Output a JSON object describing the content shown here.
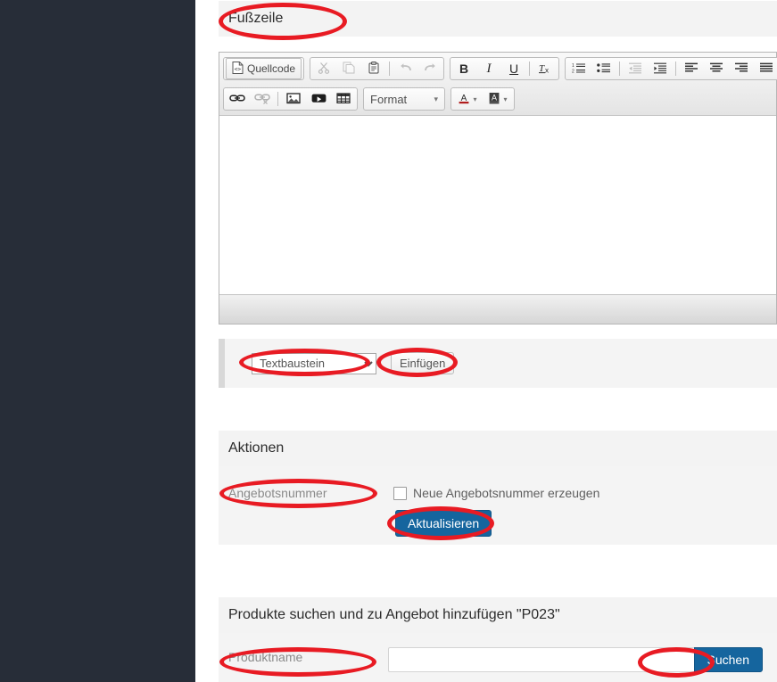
{
  "theme": {
    "sidebar_bg": "#272d38",
    "section_head_bg": "#f3f3f3",
    "primary_button_bg": "#15659e",
    "annotation_color": "#e81b23"
  },
  "footer_section": {
    "heading": "Fußzeile"
  },
  "editor": {
    "toolbar_row1": [
      {
        "name": "source-icon",
        "label": "Quellcode",
        "glyph": "</>",
        "disabled": false,
        "boxed": true
      },
      {
        "name": "cut-icon",
        "label": "",
        "glyph": "✂",
        "disabled": true,
        "boxed": false
      },
      {
        "name": "copy-icon",
        "label": "",
        "glyph": "⧉",
        "disabled": true,
        "boxed": false
      },
      {
        "name": "paste-icon",
        "label": "",
        "glyph": "📋",
        "disabled": false,
        "boxed": false
      },
      {
        "name": "undo-icon",
        "label": "",
        "glyph": "↰",
        "disabled": true,
        "boxed": false
      },
      {
        "name": "redo-icon",
        "label": "",
        "glyph": "↱",
        "disabled": true,
        "boxed": false
      },
      {
        "name": "bold-icon",
        "label": "B",
        "glyph": "B",
        "disabled": false,
        "boxed": false
      },
      {
        "name": "italic-icon",
        "label": "I",
        "glyph": "I",
        "disabled": false,
        "boxed": false
      },
      {
        "name": "underline-icon",
        "label": "U",
        "glyph": "U",
        "disabled": false,
        "boxed": false
      },
      {
        "name": "remove-format-icon",
        "label": "Tx",
        "glyph": "Tx",
        "disabled": false,
        "boxed": false
      },
      {
        "name": "numbered-list-icon",
        "label": "",
        "glyph": "1≡",
        "disabled": false,
        "boxed": false
      },
      {
        "name": "bulleted-list-icon",
        "label": "",
        "glyph": "•≡",
        "disabled": false,
        "boxed": false
      },
      {
        "name": "outdent-icon",
        "label": "",
        "glyph": "⇤≡",
        "disabled": true,
        "boxed": false
      },
      {
        "name": "indent-icon",
        "label": "",
        "glyph": "⇥≡",
        "disabled": false,
        "boxed": false
      },
      {
        "name": "align-left-icon",
        "label": "",
        "glyph": "≡",
        "disabled": false,
        "boxed": false
      },
      {
        "name": "align-center-icon",
        "label": "",
        "glyph": "≡",
        "disabled": false,
        "boxed": false
      },
      {
        "name": "align-right-icon",
        "label": "",
        "glyph": "≡",
        "disabled": false,
        "boxed": false
      },
      {
        "name": "align-justify-icon",
        "label": "",
        "glyph": "≡",
        "disabled": false,
        "boxed": false
      }
    ],
    "toolbar_row2": [
      {
        "name": "link-icon",
        "label": "",
        "glyph": "🔗",
        "disabled": false
      },
      {
        "name": "unlink-icon",
        "label": "",
        "glyph": "🔗",
        "disabled": true
      },
      {
        "name": "image-icon",
        "label": "",
        "glyph": "🖼",
        "disabled": false
      },
      {
        "name": "video-icon",
        "label": "",
        "glyph": "▶",
        "disabled": false
      },
      {
        "name": "table-icon",
        "label": "",
        "glyph": "▦",
        "disabled": false
      }
    ],
    "format_combo": {
      "label": "Format",
      "caret": "▾"
    },
    "text_color": {
      "label": "A",
      "caret": "▾"
    },
    "bg_color": {
      "label": "A",
      "caret": "▾"
    },
    "content": ""
  },
  "snippet_panel": {
    "select_value": "Textbaustein",
    "select_options": [
      "Textbaustein"
    ],
    "insert_button": "Einfügen"
  },
  "actions_section": {
    "heading": "Aktionen",
    "offer_number_label": "Angebotsnummer",
    "new_offer_checkbox_label": "Neue Angebotsnummer erzeugen",
    "new_offer_checked": false,
    "update_button": "Aktualisieren"
  },
  "product_search_section": {
    "heading": "Produkte suchen und zu Angebot hinzufügen \"P023\"",
    "product_name_label": "Produktname",
    "search_input_value": "",
    "search_input_placeholder": "",
    "search_button": "Suchen"
  }
}
